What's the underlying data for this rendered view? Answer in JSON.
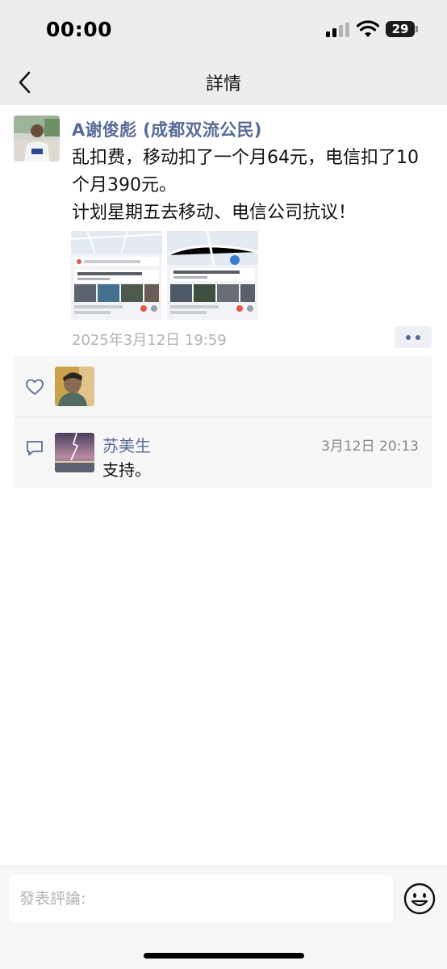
{
  "status_bar": {
    "time": "00:00",
    "battery_level": "29",
    "signal_icon": "cellular-signal-icon",
    "wifi_icon": "wifi-icon"
  },
  "nav": {
    "title": "詳情",
    "back_icon": "chevron-left-icon"
  },
  "post": {
    "author": "A谢俊彪 (成都双流公民)",
    "text_lines": [
      "乱扣费，移动扣了一个月64元，电信扣了10个月390元。",
      "计划星期五去移动、电信公司抗议！"
    ],
    "image_count": 2,
    "time": "2025年3月12日 19:59",
    "more_icon": "more-dots-icon"
  },
  "likes": {
    "icon": "heart-icon",
    "count": 1
  },
  "comments": [
    {
      "icon": "comment-bubble-icon",
      "name": "苏美生",
      "time": "3月12日 20:13",
      "text": "支持。"
    }
  ],
  "input_bar": {
    "placeholder": "發表評論:",
    "emoji_icon": "smiley-face-icon"
  },
  "colors": {
    "link_blue": "#576b95",
    "nav_background": "#ededed",
    "panel_background": "#f7f7f7",
    "meta_gray": "#b2b2b2"
  }
}
